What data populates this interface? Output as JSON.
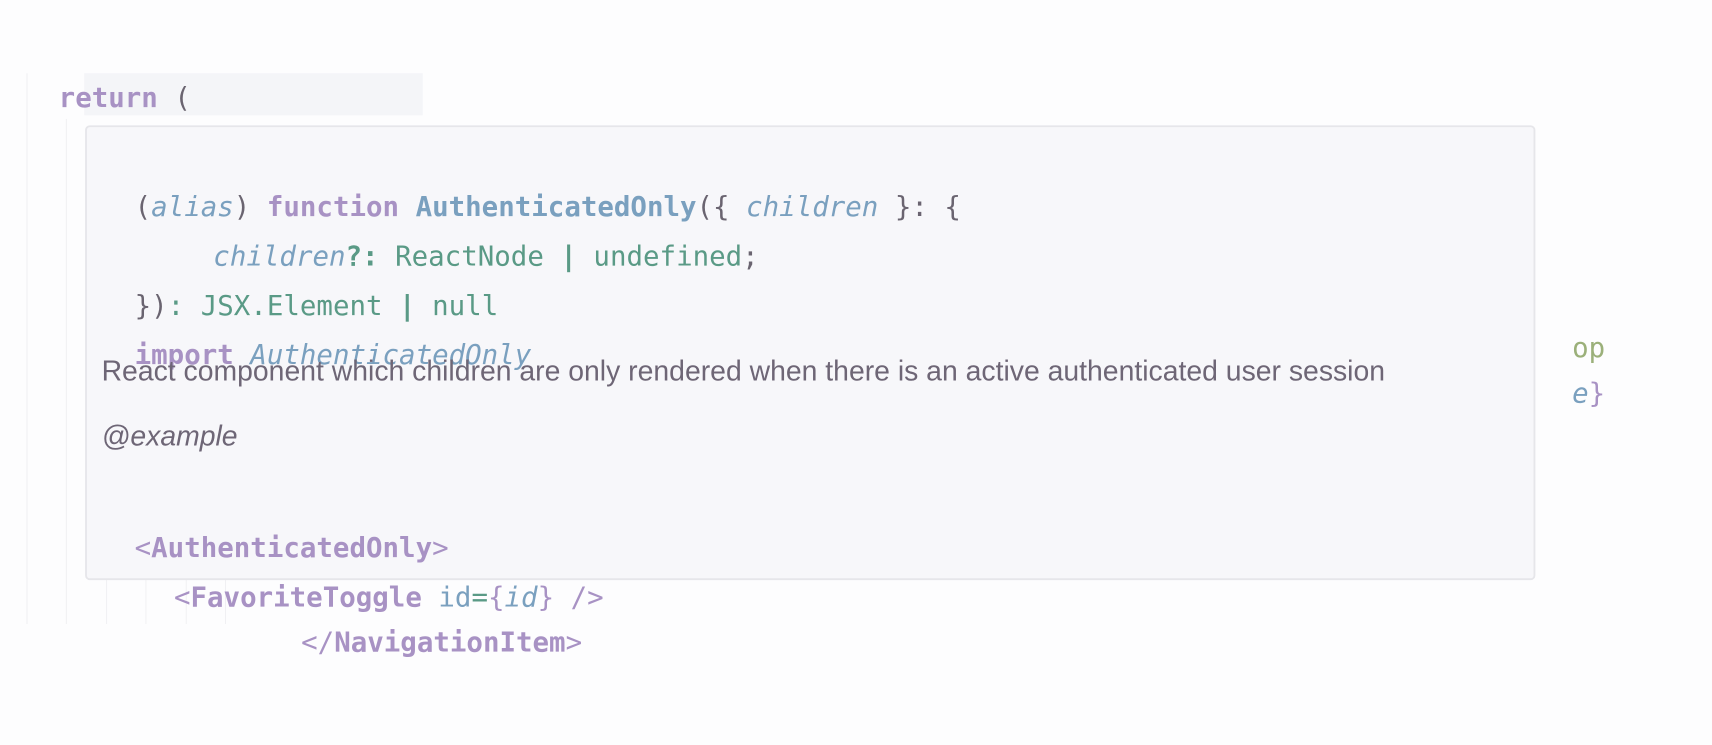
{
  "editor": {
    "line_return": {
      "keyword": "return",
      "paren": "("
    },
    "line_open_tag": {
      "lt": "<",
      "name": "AuthenticatedOnly",
      "gt": ">"
    },
    "line_close_nav": {
      "lt": "</",
      "name": "NavigationItem",
      "gt": ">"
    },
    "right_overflow": {
      "line1": "op",
      "line2_ident": "e",
      "line2_punc": "}"
    }
  },
  "hover_popup": {
    "signature": {
      "alias_open": "(",
      "alias": "alias",
      "alias_close": ")",
      "function_kw": "function",
      "function_name": "AuthenticatedOnly",
      "open": "({",
      "param": "children",
      "after_param": "}:",
      "brace": "{",
      "prop_name": "children",
      "prop_opt": "?:",
      "prop_type": "ReactNode",
      "pipe": "|",
      "prop_type2": "undefined",
      "semi": ";",
      "close": "})",
      "colon": ":",
      "return_type": "JSX.Element",
      "pipe2": "|",
      "return_type2": "null"
    },
    "import_line": {
      "keyword": "import",
      "name": "AuthenticatedOnly"
    },
    "description": "React component which children are only rendered when there is an active authenticated user session",
    "example_tag": "@example",
    "example": {
      "line1": {
        "lt": "<",
        "name": "AuthenticatedOnly",
        "gt": ">"
      },
      "line2": {
        "lt": "<",
        "name": "FavoriteToggle",
        "attr": "id",
        "eq": "=",
        "brace_open": "{",
        "value": "id",
        "brace_close": "}",
        "selfclose": "/>"
      }
    }
  },
  "colors": {
    "keyword": "#a892c4",
    "function": "#7aa0bf",
    "type": "#5a9a86",
    "link": "#4e7b9a",
    "popup_bg": "#f7f7fa"
  }
}
